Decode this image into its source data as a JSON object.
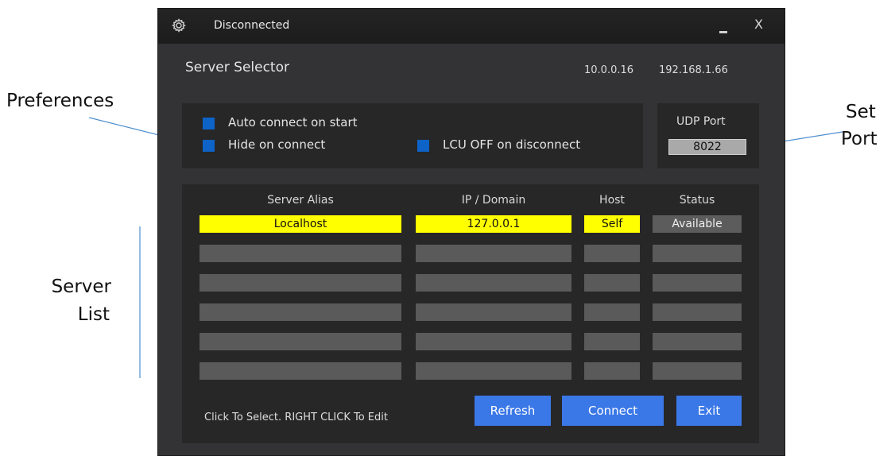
{
  "annotations": {
    "preferences": "Preferences",
    "set_port": [
      "Set",
      "Port"
    ],
    "server_list": [
      "Server",
      "List"
    ]
  },
  "window": {
    "title": "Disconnected",
    "minimize_label": "_",
    "close_label": "X",
    "heading": "Server Selector",
    "ip_addresses": [
      "10.0.0.16",
      "192.168.1.66"
    ]
  },
  "preferences": {
    "auto_connect": {
      "label": "Auto connect on start",
      "checked": true
    },
    "hide_on_connect": {
      "label": "Hide on connect",
      "checked": true
    },
    "lcu_off": {
      "label": "LCU OFF on disconnect",
      "checked": true
    }
  },
  "udp": {
    "label": "UDP Port",
    "value": "8022"
  },
  "server_list": {
    "columns": [
      "Server Alias",
      "IP / Domain",
      "Host",
      "Status"
    ],
    "rows": [
      {
        "alias": "Localhost",
        "ip": "127.0.0.1",
        "host": "Self",
        "status": "Available",
        "selected": true
      },
      {
        "alias": "",
        "ip": "",
        "host": "",
        "status": ""
      },
      {
        "alias": "",
        "ip": "",
        "host": "",
        "status": ""
      },
      {
        "alias": "",
        "ip": "",
        "host": "",
        "status": ""
      },
      {
        "alias": "",
        "ip": "",
        "host": "",
        "status": ""
      },
      {
        "alias": "",
        "ip": "",
        "host": "",
        "status": ""
      }
    ]
  },
  "hint": "Click To Select. RIGHT CLICK To Edit",
  "buttons": {
    "refresh": "Refresh",
    "connect": "Connect",
    "exit": "Exit"
  },
  "colors": {
    "window_bg": "#333335",
    "panel_bg": "#272728",
    "selected_row": "#ffff00",
    "checkbox": "#0d63c8",
    "button": "#3b78e7",
    "empty_cell": "#5a5a5a"
  },
  "icons": {
    "settings": "gear-icon"
  }
}
